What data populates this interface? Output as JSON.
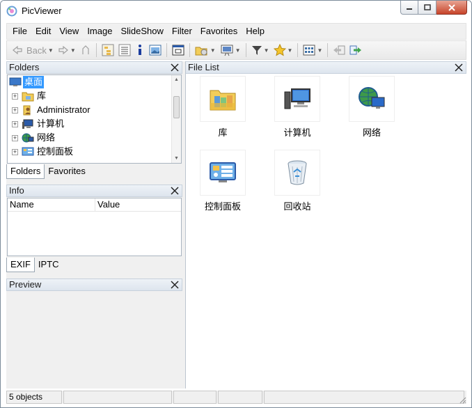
{
  "window": {
    "title": "PicViewer"
  },
  "menu": [
    {
      "label": "File",
      "name": "menu-file"
    },
    {
      "label": "Edit",
      "name": "menu-edit"
    },
    {
      "label": "View",
      "name": "menu-view"
    },
    {
      "label": "Image",
      "name": "menu-image"
    },
    {
      "label": "SlideShow",
      "name": "menu-slideshow"
    },
    {
      "label": "Filter",
      "name": "menu-filter"
    },
    {
      "label": "Favorites",
      "name": "menu-favorites"
    },
    {
      "label": "Help",
      "name": "menu-help"
    }
  ],
  "toolbar": {
    "back_label": "Back"
  },
  "folders_panel": {
    "title": "Folders",
    "root": "桌面",
    "items": [
      "库",
      "Administrator",
      "计算机",
      "网络",
      "控制面板"
    ],
    "tabs": [
      "Folders",
      "Favorites"
    ]
  },
  "info_panel": {
    "title": "Info",
    "columns": [
      "Name",
      "Value"
    ],
    "tabs": [
      "EXIF",
      "IPTC"
    ]
  },
  "preview_panel": {
    "title": "Preview"
  },
  "file_list": {
    "title": "File List",
    "items": [
      {
        "label": "库",
        "icon": "library-icon"
      },
      {
        "label": "计算机",
        "icon": "computer-icon"
      },
      {
        "label": "网络",
        "icon": "network-icon"
      },
      {
        "label": "控制面板",
        "icon": "control-panel-icon"
      },
      {
        "label": "回收站",
        "icon": "recycle-bin-icon"
      }
    ]
  },
  "status": {
    "count": "5 objects"
  },
  "colors": {
    "selection": "#3399ff",
    "panel_header": "#dde5ee",
    "close_button": "#c7442a"
  }
}
